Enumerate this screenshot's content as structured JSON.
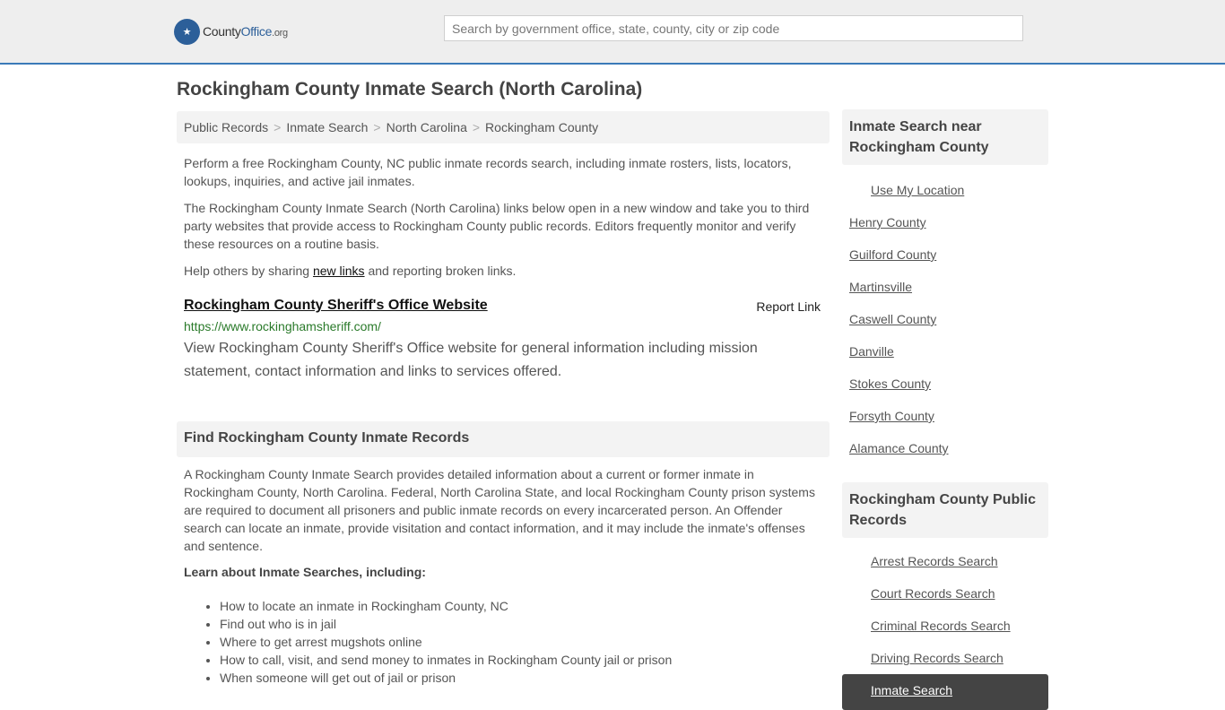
{
  "header": {
    "logo_county": "County",
    "logo_office": "Office",
    "logo_org": ".org",
    "search_placeholder": "Search by government office, state, county, city or zip code"
  },
  "page_title": "Rockingham County Inmate Search (North Carolina)",
  "breadcrumb": [
    "Public Records",
    "Inmate Search",
    "North Carolina",
    "Rockingham County"
  ],
  "intro": {
    "p1": "Perform a free Rockingham County, NC public inmate records search, including inmate rosters, lists, locators, lookups, inquiries, and active jail inmates.",
    "p2": "The Rockingham County Inmate Search (North Carolina) links below open in a new window and take you to third party websites that provide access to Rockingham County public records. Editors frequently monitor and verify these resources on a routine basis.",
    "p3_before": "Help others by sharing ",
    "p3_link": "new links",
    "p3_after": " and reporting broken links."
  },
  "result": {
    "title": "Rockingham County Sheriff's Office Website",
    "report": "Report Link",
    "url": "https://www.rockinghamsheriff.com/",
    "desc": "View Rockingham County Sheriff's Office website for general information including mission statement, contact information and links to services offered."
  },
  "section": {
    "title": "Find Rockingham County Inmate Records",
    "body": "A Rockingham County Inmate Search provides detailed information about a current or former inmate in Rockingham County, North Carolina. Federal, North Carolina State, and local Rockingham County prison systems are required to document all prisoners and public inmate records on every incarcerated person. An Offender search can locate an inmate, provide visitation and contact information, and it may include the inmate's offenses and sentence.",
    "learn": "Learn about Inmate Searches, including:",
    "bullets": [
      "How to locate an inmate in Rockingham County, NC",
      "Find out who is in jail",
      "Where to get arrest mugshots online",
      "How to call, visit, and send money to inmates in Rockingham County jail or prison",
      "When someone will get out of jail or prison"
    ]
  },
  "sidebar": {
    "near_title": "Inmate Search near Rockingham County",
    "use_location": "Use My Location",
    "near": [
      "Henry County",
      "Guilford County",
      "Martinsville",
      "Caswell County",
      "Danville",
      "Stokes County",
      "Forsyth County",
      "Alamance County"
    ],
    "records_title": "Rockingham County Public Records",
    "records": [
      "Arrest Records Search",
      "Court Records Search",
      "Criminal Records Search",
      "Driving Records Search"
    ],
    "active": "Inmate Search"
  }
}
